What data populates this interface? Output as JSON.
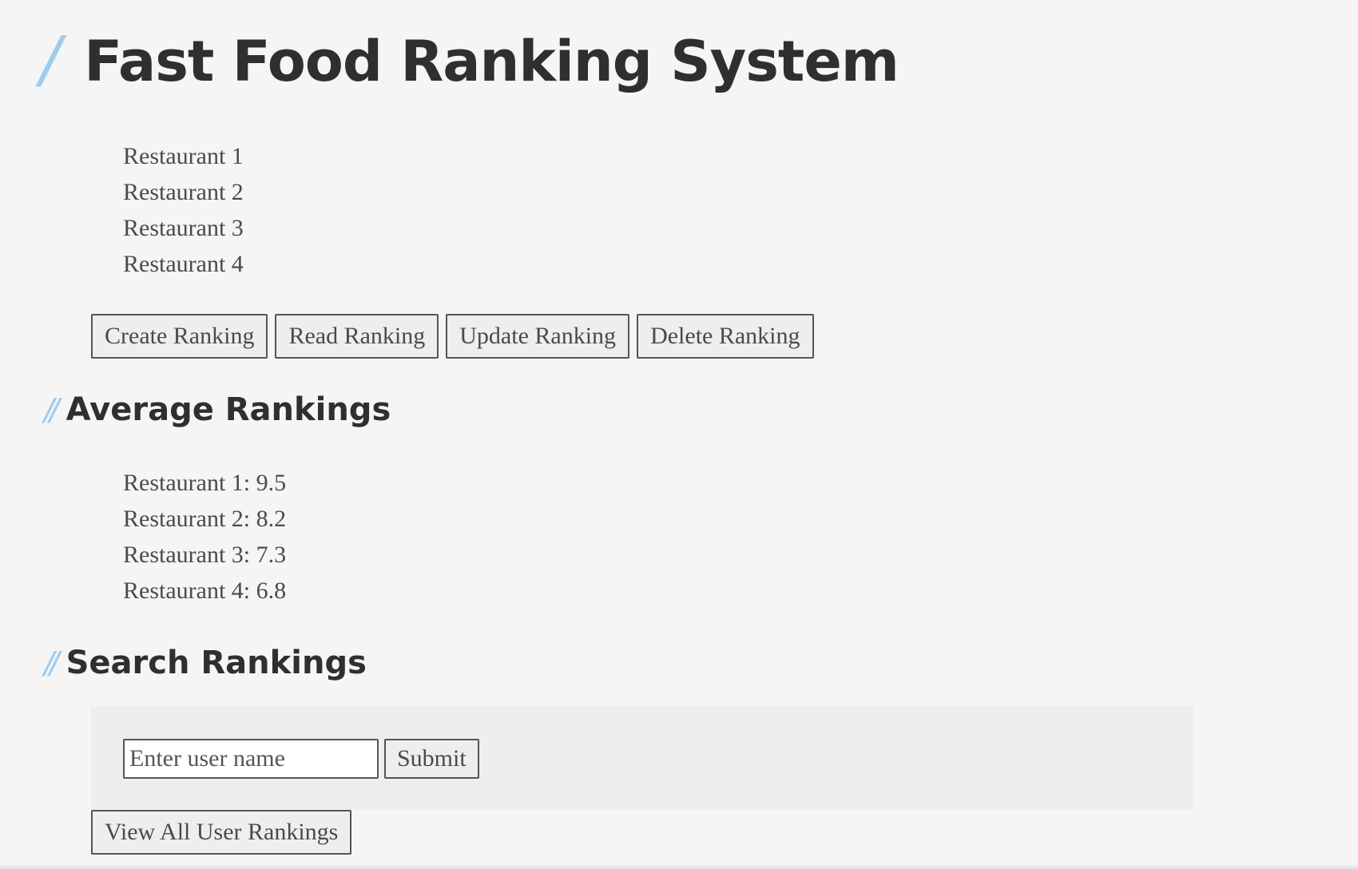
{
  "page": {
    "title": "Fast Food Ranking System",
    "title_marker": "/",
    "section_marker": "//"
  },
  "restaurants": [
    "Restaurant 1",
    "Restaurant 2",
    "Restaurant 3",
    "Restaurant 4"
  ],
  "actions": {
    "create": "Create Ranking",
    "read": "Read Ranking",
    "update": "Update Ranking",
    "delete": "Delete Ranking"
  },
  "averages": {
    "title": "Average Rankings",
    "items": [
      "Restaurant 1: 9.5",
      "Restaurant 2: 8.2",
      "Restaurant 3: 7.3",
      "Restaurant 4: 6.8"
    ]
  },
  "search": {
    "title": "Search Rankings",
    "placeholder": "Enter user name",
    "value": "",
    "submit_label": "Submit",
    "view_all_label": "View All User Rankings"
  },
  "colors": {
    "background": "#f5f5f5",
    "heading": "#2f2f2f",
    "marker": "#9ccbee",
    "text": "#4a4a4a",
    "panel": "#eeeeee"
  }
}
